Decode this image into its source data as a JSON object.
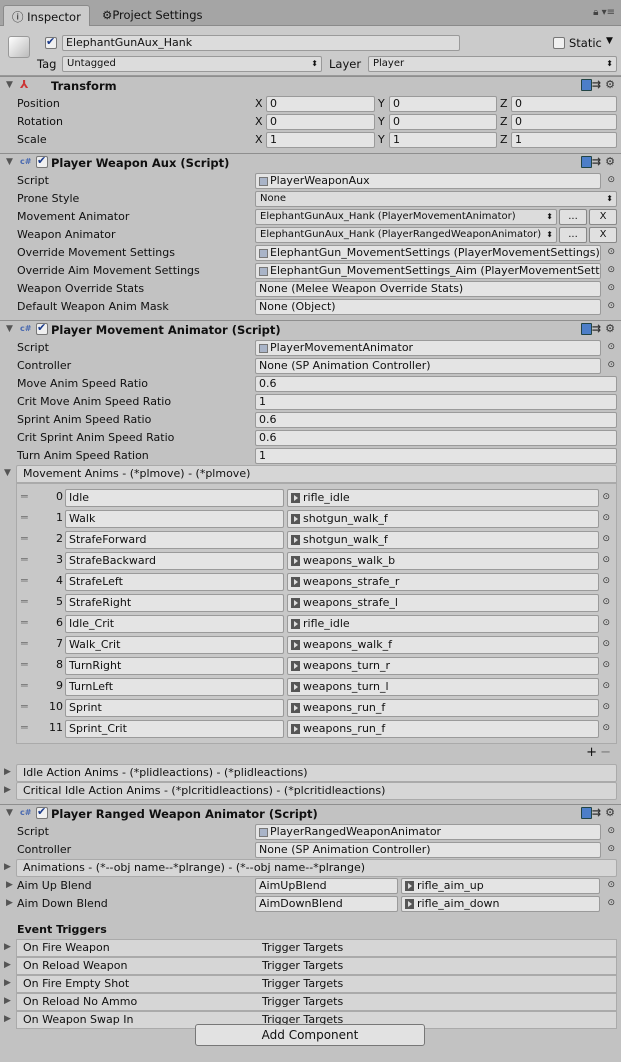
{
  "tabs": {
    "inspector": "Inspector",
    "project_settings": "Project Settings"
  },
  "object": {
    "name": "ElephantGunAux_Hank",
    "static_label": "Static",
    "tag_label": "Tag",
    "tag": "Untagged",
    "layer_label": "Layer",
    "layer": "Player"
  },
  "transform": {
    "title": "Transform",
    "rows": [
      {
        "label": "Position",
        "x": "0",
        "y": "0",
        "z": "0"
      },
      {
        "label": "Rotation",
        "x": "0",
        "y": "0",
        "z": "0"
      },
      {
        "label": "Scale",
        "x": "1",
        "y": "1",
        "z": "1"
      }
    ],
    "axis": {
      "x": "X",
      "y": "Y",
      "z": "Z"
    }
  },
  "weapon_aux": {
    "title": "Player Weapon Aux (Script)",
    "rows": [
      {
        "label": "Script",
        "value": "PlayerWeaponAux"
      },
      {
        "label": "Prone Style",
        "value": "None"
      },
      {
        "label": "Movement Animator",
        "value": "ElephantGunAux_Hank (PlayerMovementAnimator)"
      },
      {
        "label": "Weapon Animator",
        "value": "ElephantGunAux_Hank (PlayerRangedWeaponAnimator)"
      },
      {
        "label": "Override Movement Settings",
        "value": "ElephantGun_MovementSettings (PlayerMovementSettings)"
      },
      {
        "label": "Override Aim Movement Settings",
        "value": "ElephantGun_MovementSettings_Aim (PlayerMovementSettings)"
      },
      {
        "label": "Weapon Override Stats",
        "value": "None (Melee Weapon Override Stats)"
      },
      {
        "label": "Default Weapon Anim Mask",
        "value": "None (Object)"
      }
    ],
    "dots": "...",
    "x": "X"
  },
  "movement_animator": {
    "title": "Player Movement Animator (Script)",
    "rows": [
      {
        "label": "Script",
        "value": "PlayerMovementAnimator"
      },
      {
        "label": "Controller",
        "value": "None (SP Animation Controller)"
      },
      {
        "label": "Move Anim Speed Ratio",
        "value": "0.6"
      },
      {
        "label": "Crit Move Anim Speed Ratio",
        "value": "1"
      },
      {
        "label": "Sprint Anim Speed Ratio",
        "value": "0.6"
      },
      {
        "label": "Crit Sprint Anim Speed Ratio",
        "value": "0.6"
      },
      {
        "label": "Turn Anim Speed Ration",
        "value": "1"
      }
    ],
    "list_title": "Movement Anims - (*plmove) - (*plmove)",
    "list": [
      {
        "i": "0",
        "name": "Idle",
        "clip": "rifle_idle"
      },
      {
        "i": "1",
        "name": "Walk",
        "clip": "shotgun_walk_f"
      },
      {
        "i": "2",
        "name": "StrafeForward",
        "clip": "shotgun_walk_f"
      },
      {
        "i": "3",
        "name": "StrafeBackward",
        "clip": "weapons_walk_b"
      },
      {
        "i": "4",
        "name": "StrafeLeft",
        "clip": "weapons_strafe_r"
      },
      {
        "i": "5",
        "name": "StrafeRight",
        "clip": "weapons_strafe_l"
      },
      {
        "i": "6",
        "name": "Idle_Crit",
        "clip": "rifle_idle"
      },
      {
        "i": "7",
        "name": "Walk_Crit",
        "clip": "weapons_walk_f"
      },
      {
        "i": "8",
        "name": "TurnRight",
        "clip": "weapons_turn_r"
      },
      {
        "i": "9",
        "name": "TurnLeft",
        "clip": "weapons_turn_l"
      },
      {
        "i": "10",
        "name": "Sprint",
        "clip": "weapons_run_f"
      },
      {
        "i": "11",
        "name": "Sprint_Crit",
        "clip": "weapons_run_f"
      }
    ],
    "plus": "+",
    "minus": "−",
    "idle_actions": "Idle Action Anims - (*plidleactions) - (*plidleactions)",
    "crit_idle_actions": "Critical Idle Action Anims - (*plcritidleactions) - (*plcritidleactions)"
  },
  "ranged_animator": {
    "title": "Player Ranged Weapon Animator (Script)",
    "script_label": "Script",
    "script": "PlayerRangedWeaponAnimator",
    "controller_label": "Controller",
    "controller": "None (SP Animation Controller)",
    "animations": "Animations - (*--obj name--*plrange) - (*--obj name--*plrange)",
    "blends": [
      {
        "label": "Aim Up Blend",
        "param": "AimUpBlend",
        "clip": "rifle_aim_up"
      },
      {
        "label": "Aim Down Blend",
        "param": "AimDownBlend",
        "clip": "rifle_aim_down"
      }
    ],
    "event_title": "Event Triggers",
    "events": [
      {
        "label": "On Fire Weapon",
        "value": "Trigger Targets"
      },
      {
        "label": "On Reload Weapon",
        "value": "Trigger Targets"
      },
      {
        "label": "On Fire Empty Shot",
        "value": "Trigger Targets"
      },
      {
        "label": "On Reload No Ammo",
        "value": "Trigger Targets"
      },
      {
        "label": "On Weapon Swap In",
        "value": "Trigger Targets"
      }
    ]
  },
  "add_component": "Add Component"
}
